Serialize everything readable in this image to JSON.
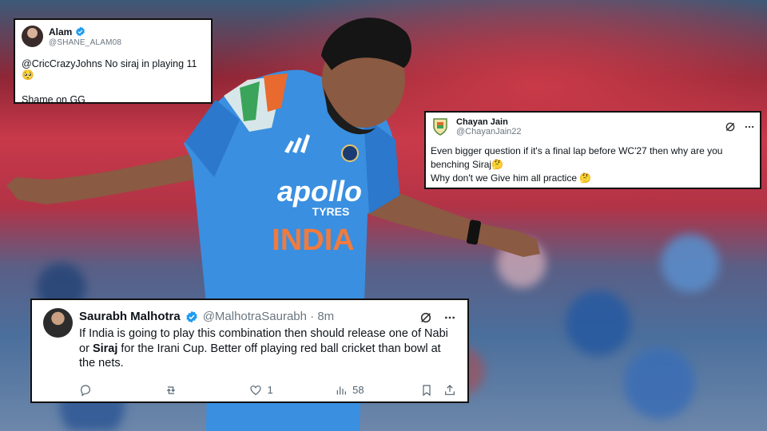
{
  "tweets": {
    "alam": {
      "name": "Alam",
      "handle": "@SHANE_ALAM08",
      "line1": "@CricCrazyJohns No siraj in playing 11 🥺",
      "line2": "Shame on GG"
    },
    "chayan": {
      "name": "Chayan Jain",
      "handle": "@ChayanJain22",
      "line1": "Even bigger question if it's a final lap before WC'27 then why are you",
      "line2": "benching Siraj🤔",
      "line3": "Why don't we Give him all practice 🤔"
    },
    "saurabh": {
      "name": "Saurabh Malhotra",
      "handle_time": "@MalhotraSaurabh · 8m",
      "body_part1": "If India is going to play this combination then should release one of Nabi or",
      "body_bold": "Siraj",
      "body_part2": "for the Irani Cup. Better off playing red ball cricket than bowl at the nets.",
      "likes": "1",
      "views": "58"
    }
  },
  "jersey": {
    "sponsor": "apollo",
    "sponsor_sub": "TYRES",
    "country": "INDIA"
  },
  "colors": {
    "verified": "#1d9bf0",
    "jersey": "#3a8fe0",
    "accent_orange": "#f07b3f"
  }
}
